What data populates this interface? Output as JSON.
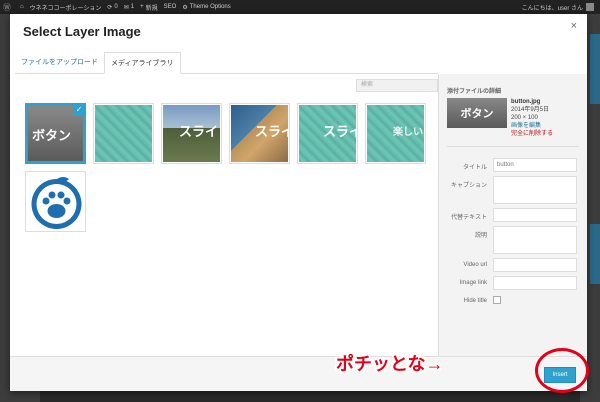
{
  "admin_bar": {
    "site_name": "ウネネココーポレーション",
    "comments_count": "1",
    "updates_count": "0",
    "new_label": "新規",
    "seo_label": "SEO",
    "theme_options_label": "Theme Options",
    "greeting": "こんにちは、user さん"
  },
  "modal": {
    "title": "Select Layer Image",
    "close_label": "×",
    "tabs": [
      {
        "label": "ファイルをアップロード"
      },
      {
        "label": "メディアライブラリ"
      }
    ],
    "search_placeholder": "検索",
    "thumbnails": [
      {
        "text": "ボタン",
        "style": "gray",
        "selected": true
      },
      {
        "text": "",
        "style": "teal"
      },
      {
        "text": "スライ",
        "style": "photo1"
      },
      {
        "text": "スライ",
        "style": "photo2"
      },
      {
        "text": "スライ",
        "style": "teal"
      },
      {
        "text": "楽しい",
        "style": "teal"
      },
      {
        "text": "",
        "style": "paw"
      }
    ],
    "check_mark": "✓"
  },
  "details": {
    "heading": "添付ファイルの詳細",
    "preview_text": "ボタン",
    "filename": "button.jpg",
    "date": "2014年9月5日",
    "dimensions": "200 × 100",
    "edit_link": "画像を編集",
    "delete_link": "完全に削除する",
    "fields": {
      "title_label": "タイトル",
      "title_value": "button",
      "caption_label": "キャプション",
      "alt_label": "代替テキスト",
      "description_label": "説明",
      "video_url_label": "Video url",
      "image_link_label": "Image link",
      "hide_title_label": "Hide title"
    }
  },
  "footer": {
    "insert_label": "Insert"
  },
  "annotation": {
    "text": "ポチッとな→"
  }
}
